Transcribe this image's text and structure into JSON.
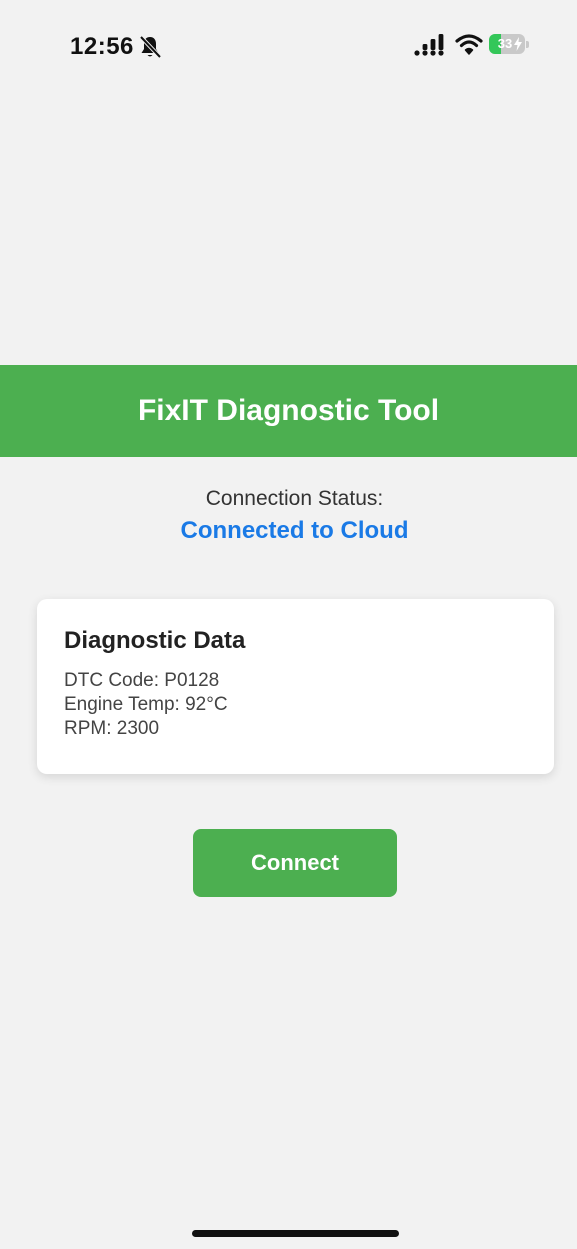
{
  "status_bar": {
    "time": "12:56",
    "battery_level": "33",
    "battery_fraction": 0.33,
    "icons": [
      "bell-slash-icon",
      "cellular-signal-icon",
      "wifi-icon",
      "battery-charging-icon"
    ]
  },
  "header": {
    "title": "FixIT Diagnostic Tool",
    "background_color": "#4caf50"
  },
  "connection": {
    "label": "Connection Status:",
    "value": "Connected to Cloud",
    "value_color": "#1a7ae6"
  },
  "diagnostic_card": {
    "title": "Diagnostic Data",
    "lines": [
      "DTC Code: P0128",
      "Engine Temp: 92°C",
      "RPM: 2300"
    ]
  },
  "actions": {
    "connect_label": "Connect",
    "button_color": "#4caf50"
  }
}
